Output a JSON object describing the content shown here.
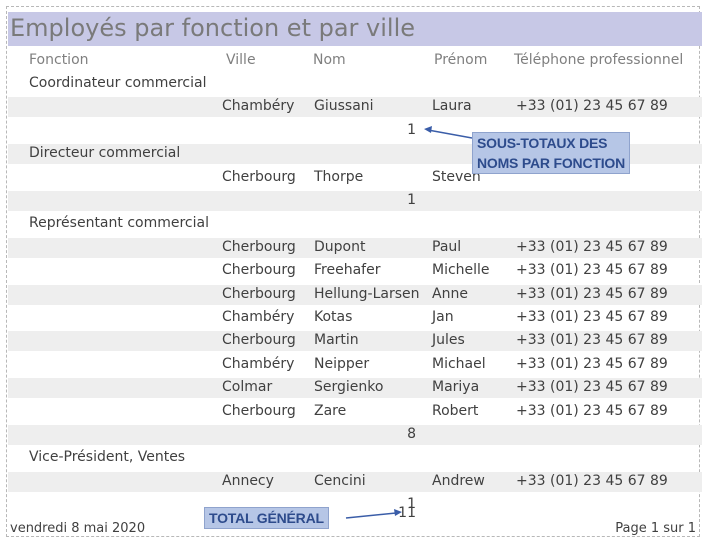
{
  "report": {
    "title": "Employés par fonction et par ville",
    "columns": [
      "Fonction",
      "Ville",
      "Nom",
      "Prénom",
      "Téléphone professionnel"
    ],
    "groups": [
      {
        "fonction": "Coordinateur commercial",
        "rows": [
          {
            "ville": "Chambéry",
            "nom": "Giussani",
            "prenom": "Laura",
            "tel": "+33 (01) 23 45 67 89"
          }
        ],
        "count": "1"
      },
      {
        "fonction": "Directeur commercial",
        "rows": [
          {
            "ville": "Cherbourg",
            "nom": "Thorpe",
            "prenom": "Steven",
            "tel": ""
          }
        ],
        "count": "1"
      },
      {
        "fonction": "Représentant commercial",
        "rows": [
          {
            "ville": "Cherbourg",
            "nom": "Dupont",
            "prenom": "Paul",
            "tel": "+33 (01) 23 45 67 89"
          },
          {
            "ville": "Cherbourg",
            "nom": "Freehafer",
            "prenom": "Michelle",
            "tel": "+33 (01) 23 45 67 89"
          },
          {
            "ville": "Cherbourg",
            "nom": "Hellung-Larsen",
            "prenom": "Anne",
            "tel": "+33 (01) 23 45 67 89"
          },
          {
            "ville": "Chambéry",
            "nom": "Kotas",
            "prenom": "Jan",
            "tel": "+33 (01) 23 45 67 89"
          },
          {
            "ville": "Cherbourg",
            "nom": "Martin",
            "prenom": "Jules",
            "tel": "+33 (01) 23 45 67 89"
          },
          {
            "ville": "Chambéry",
            "nom": "Neipper",
            "prenom": "Michael",
            "tel": "+33 (01) 23 45 67 89"
          },
          {
            "ville": "Colmar",
            "nom": "Sergienko",
            "prenom": "Mariya",
            "tel": "+33 (01) 23 45 67 89"
          },
          {
            "ville": "Cherbourg",
            "nom": "Zare",
            "prenom": "Robert",
            "tel": "+33 (01) 23 45 67 89"
          }
        ],
        "count": "8"
      },
      {
        "fonction": "Vice-Président, Ventes",
        "rows": [
          {
            "ville": "Annecy",
            "nom": "Cencini",
            "prenom": "Andrew",
            "tel": "+33 (01) 23 45 67 89"
          }
        ],
        "count": "1"
      }
    ],
    "grand_total": "11",
    "footer_date": "vendredi 8 mai 2020",
    "footer_page": "Page 1 sur 1"
  },
  "callouts": {
    "subtotals_line1": "SOUS-TOTAUX DES",
    "subtotals_line2": "NOMS PAR FONCTION",
    "grand_total_label": "TOTAL GÉNÉRAL"
  },
  "colors": {
    "title_band": "#c7c8e6",
    "alt_band": "#eeeeee",
    "callout_fill": "#b6c6e6",
    "callout_text": "#2d4b8c",
    "arrow": "#3a5da8"
  }
}
